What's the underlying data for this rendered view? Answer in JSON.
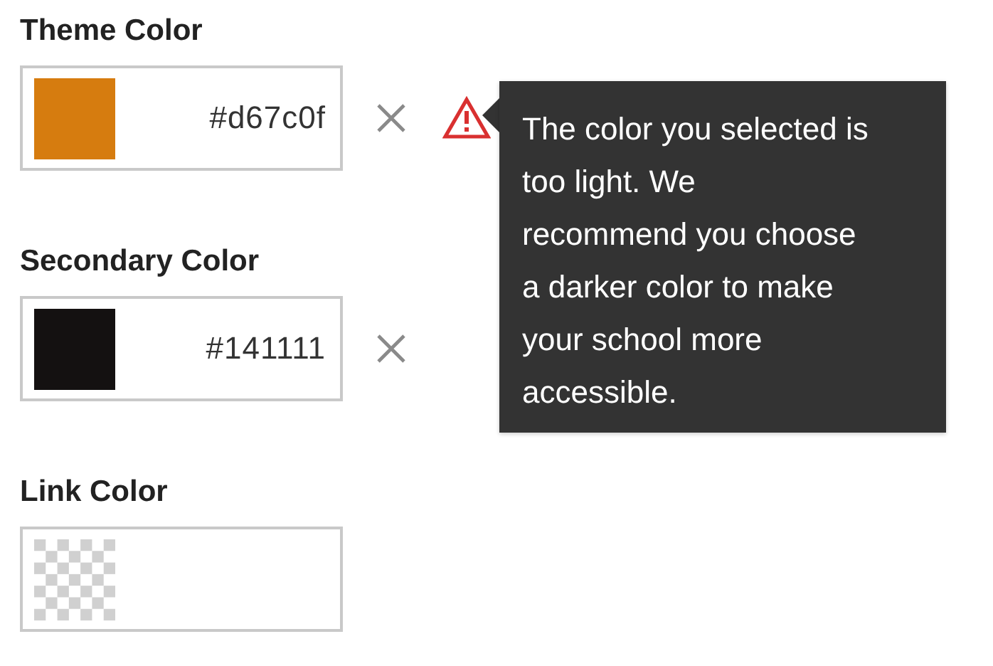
{
  "fields": [
    {
      "label": "Theme Color",
      "color": "#d67c0f",
      "value": "#d67c0f",
      "clearable": true,
      "warning": true,
      "tooltip": "The color you selected is\ntoo light. We\nrecommend you choose\na darker color to make\nyour school more\naccessible."
    },
    {
      "label": "Secondary Color",
      "color": "#141111",
      "value": "#141111",
      "clearable": true,
      "warning": false
    },
    {
      "label": "Link Color",
      "clearable": false,
      "warning": false
    }
  ]
}
